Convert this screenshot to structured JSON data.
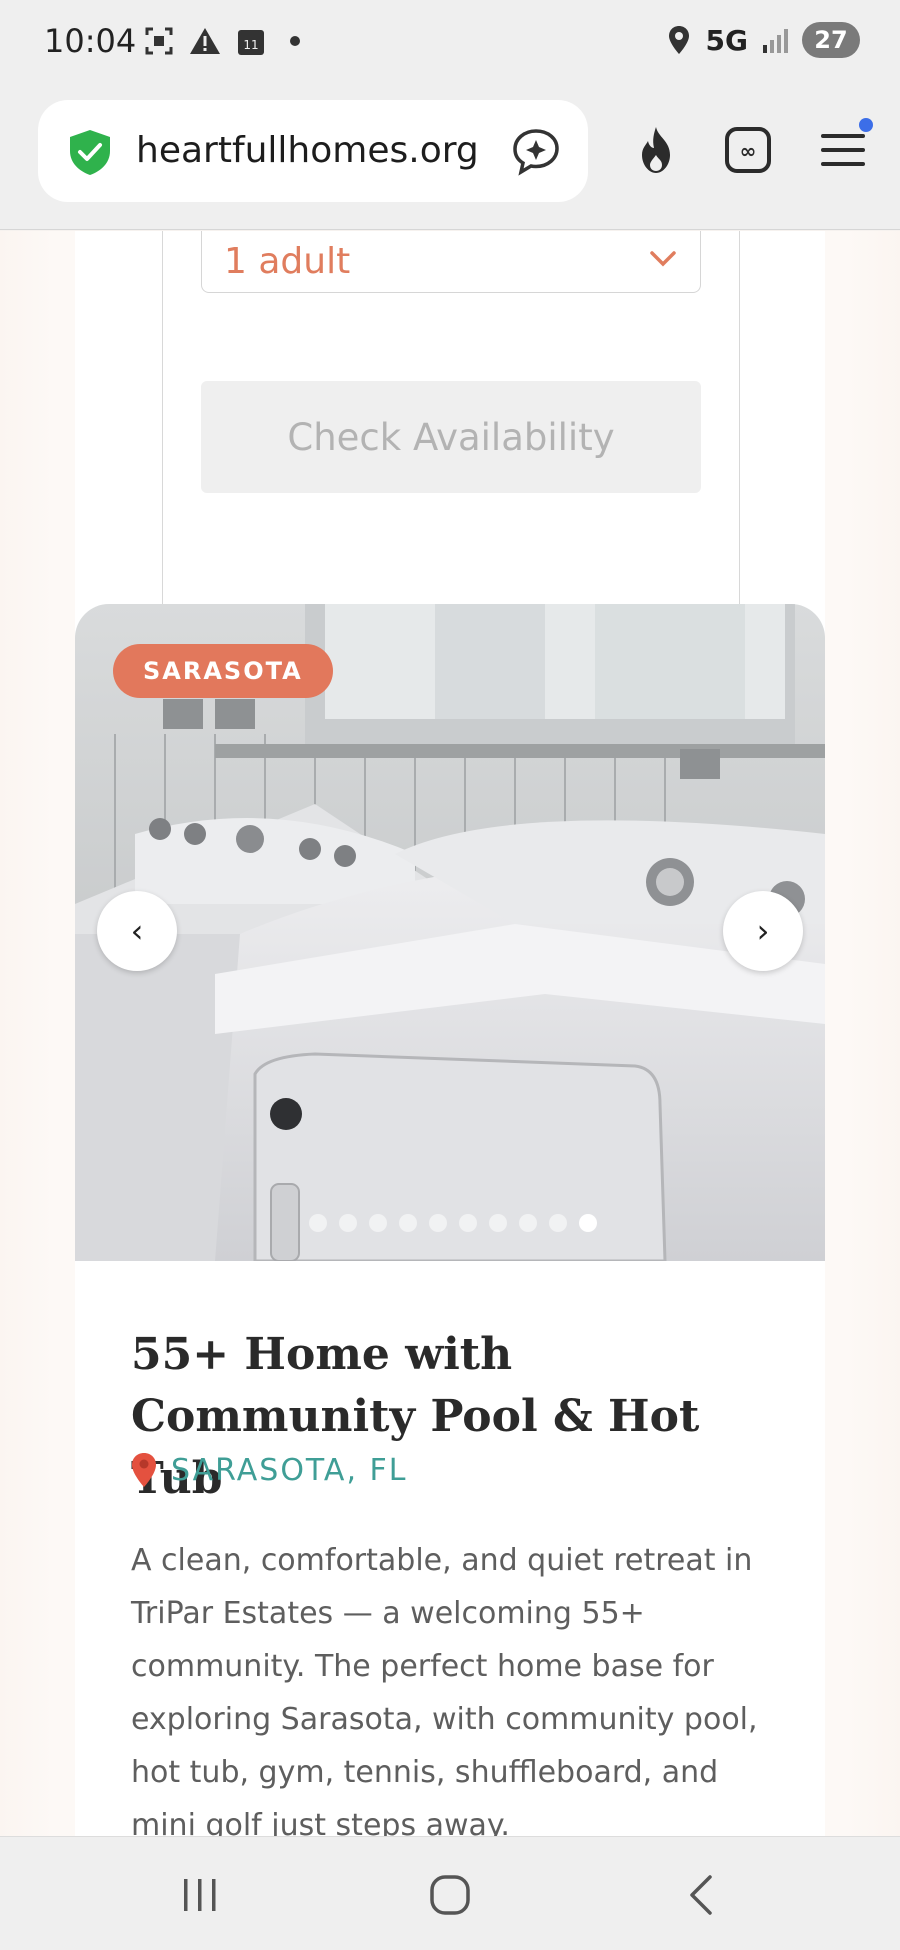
{
  "status_bar": {
    "time": "10:04",
    "network": "5G",
    "battery": "27",
    "icons": [
      "screenshot-icon",
      "warning-icon",
      "calendar-icon",
      "location-icon",
      "signal-icon"
    ]
  },
  "browser": {
    "url": "heartfullhomes.org",
    "badge_count": "11",
    "colors": {
      "shield": "#2fb24c",
      "notification": "#3c6ee8"
    }
  },
  "booking": {
    "guests_value": "1 adult",
    "check_button": "Check Availability"
  },
  "listing": {
    "badge": "SARASOTA",
    "prev_arrow": "‹",
    "next_arrow": "›",
    "photo_count": 10,
    "active_photo": 10,
    "title": "55+ Home with Community Pool & Hot Tub",
    "location": "SARASOTA, FL",
    "description": "A clean, comfortable, and quiet retreat in TriPar Estates — a welcoming 55+ community. The perfect home base for exploring Sarasota, with community pool, hot tub, gym, tennis, shuffleboard, and mini golf just steps away."
  },
  "colors": {
    "accent": "#e2785c",
    "teal": "#3f9e96"
  }
}
